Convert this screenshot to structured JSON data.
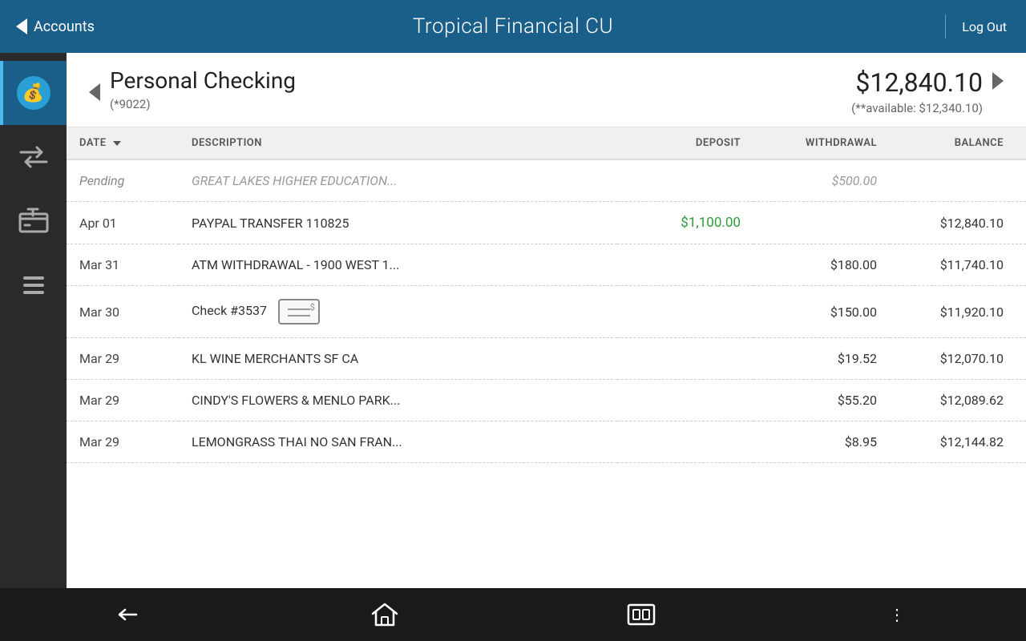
{
  "header": {
    "back_label": "Accounts",
    "title": "Tropical Financial CU",
    "logout_label": "Log Out"
  },
  "account": {
    "name": "Personal Checking",
    "number": "(*9022)",
    "balance": "$12,840.10",
    "available": "(**available: $12,340.10)"
  },
  "table": {
    "columns": {
      "date": "DATE",
      "description": "DESCRIPTION",
      "deposit": "DEPOSIT",
      "withdrawal": "WITHDRAWAL",
      "balance": "BALANCE"
    },
    "rows": [
      {
        "date": "Pending",
        "description": "GREAT LAKES HIGHER EDUCATION...",
        "deposit": "",
        "withdrawal": "$500.00",
        "balance": "",
        "pending": true,
        "has_check": false
      },
      {
        "date": "Apr 01",
        "description": "PAYPAL TRANSFER 110825",
        "deposit": "$1,100.00",
        "withdrawal": "",
        "balance": "$12,840.10",
        "pending": false,
        "has_check": false
      },
      {
        "date": "Mar 31",
        "description": "ATM WITHDRAWAL - 1900 WEST 1...",
        "deposit": "",
        "withdrawal": "$180.00",
        "balance": "$11,740.10",
        "pending": false,
        "has_check": false
      },
      {
        "date": "Mar 30",
        "description": "Check #3537",
        "deposit": "",
        "withdrawal": "$150.00",
        "balance": "$11,920.10",
        "pending": false,
        "has_check": true
      },
      {
        "date": "Mar 29",
        "description": "KL WINE MERCHANTS SF CA",
        "deposit": "",
        "withdrawal": "$19.52",
        "balance": "$12,070.10",
        "pending": false,
        "has_check": false
      },
      {
        "date": "Mar 29",
        "description": "CINDY'S FLOWERS & MENLO PARK...",
        "deposit": "",
        "withdrawal": "$55.20",
        "balance": "$12,089.62",
        "pending": false,
        "has_check": false
      },
      {
        "date": "Mar 29",
        "description": "LEMONGRASS THAI NO SAN FRAN...",
        "deposit": "",
        "withdrawal": "$8.95",
        "balance": "$12,144.82",
        "pending": false,
        "has_check": false
      }
    ]
  },
  "bottom_nav": {
    "back": "back",
    "home": "home",
    "recents": "recents",
    "more": "⋮"
  }
}
